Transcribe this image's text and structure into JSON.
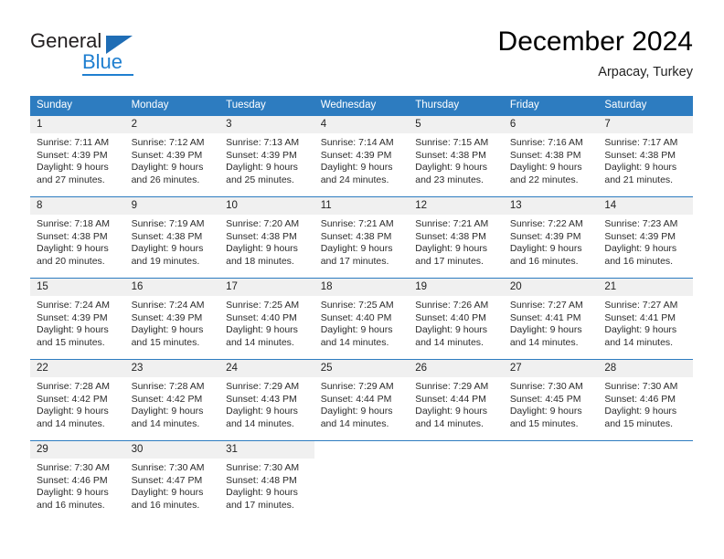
{
  "brand": {
    "name_part1": "General",
    "name_part2": "Blue",
    "triangle_color": "#1f6db5",
    "blue_color": "#1f7fd0"
  },
  "header": {
    "title": "December 2024",
    "subtitle": "Arpacay, Turkey",
    "header_bg": "#2d7cc0",
    "daynum_bg": "#f0f0f0"
  },
  "weekday_headers": [
    "Sunday",
    "Monday",
    "Tuesday",
    "Wednesday",
    "Thursday",
    "Friday",
    "Saturday"
  ],
  "weeks": [
    [
      {
        "day": "1",
        "sunrise": "Sunrise: 7:11 AM",
        "sunset": "Sunset: 4:39 PM",
        "daylight_l1": "Daylight: 9 hours",
        "daylight_l2": "and 27 minutes."
      },
      {
        "day": "2",
        "sunrise": "Sunrise: 7:12 AM",
        "sunset": "Sunset: 4:39 PM",
        "daylight_l1": "Daylight: 9 hours",
        "daylight_l2": "and 26 minutes."
      },
      {
        "day": "3",
        "sunrise": "Sunrise: 7:13 AM",
        "sunset": "Sunset: 4:39 PM",
        "daylight_l1": "Daylight: 9 hours",
        "daylight_l2": "and 25 minutes."
      },
      {
        "day": "4",
        "sunrise": "Sunrise: 7:14 AM",
        "sunset": "Sunset: 4:39 PM",
        "daylight_l1": "Daylight: 9 hours",
        "daylight_l2": "and 24 minutes."
      },
      {
        "day": "5",
        "sunrise": "Sunrise: 7:15 AM",
        "sunset": "Sunset: 4:38 PM",
        "daylight_l1": "Daylight: 9 hours",
        "daylight_l2": "and 23 minutes."
      },
      {
        "day": "6",
        "sunrise": "Sunrise: 7:16 AM",
        "sunset": "Sunset: 4:38 PM",
        "daylight_l1": "Daylight: 9 hours",
        "daylight_l2": "and 22 minutes."
      },
      {
        "day": "7",
        "sunrise": "Sunrise: 7:17 AM",
        "sunset": "Sunset: 4:38 PM",
        "daylight_l1": "Daylight: 9 hours",
        "daylight_l2": "and 21 minutes."
      }
    ],
    [
      {
        "day": "8",
        "sunrise": "Sunrise: 7:18 AM",
        "sunset": "Sunset: 4:38 PM",
        "daylight_l1": "Daylight: 9 hours",
        "daylight_l2": "and 20 minutes."
      },
      {
        "day": "9",
        "sunrise": "Sunrise: 7:19 AM",
        "sunset": "Sunset: 4:38 PM",
        "daylight_l1": "Daylight: 9 hours",
        "daylight_l2": "and 19 minutes."
      },
      {
        "day": "10",
        "sunrise": "Sunrise: 7:20 AM",
        "sunset": "Sunset: 4:38 PM",
        "daylight_l1": "Daylight: 9 hours",
        "daylight_l2": "and 18 minutes."
      },
      {
        "day": "11",
        "sunrise": "Sunrise: 7:21 AM",
        "sunset": "Sunset: 4:38 PM",
        "daylight_l1": "Daylight: 9 hours",
        "daylight_l2": "and 17 minutes."
      },
      {
        "day": "12",
        "sunrise": "Sunrise: 7:21 AM",
        "sunset": "Sunset: 4:38 PM",
        "daylight_l1": "Daylight: 9 hours",
        "daylight_l2": "and 17 minutes."
      },
      {
        "day": "13",
        "sunrise": "Sunrise: 7:22 AM",
        "sunset": "Sunset: 4:39 PM",
        "daylight_l1": "Daylight: 9 hours",
        "daylight_l2": "and 16 minutes."
      },
      {
        "day": "14",
        "sunrise": "Sunrise: 7:23 AM",
        "sunset": "Sunset: 4:39 PM",
        "daylight_l1": "Daylight: 9 hours",
        "daylight_l2": "and 16 minutes."
      }
    ],
    [
      {
        "day": "15",
        "sunrise": "Sunrise: 7:24 AM",
        "sunset": "Sunset: 4:39 PM",
        "daylight_l1": "Daylight: 9 hours",
        "daylight_l2": "and 15 minutes."
      },
      {
        "day": "16",
        "sunrise": "Sunrise: 7:24 AM",
        "sunset": "Sunset: 4:39 PM",
        "daylight_l1": "Daylight: 9 hours",
        "daylight_l2": "and 15 minutes."
      },
      {
        "day": "17",
        "sunrise": "Sunrise: 7:25 AM",
        "sunset": "Sunset: 4:40 PM",
        "daylight_l1": "Daylight: 9 hours",
        "daylight_l2": "and 14 minutes."
      },
      {
        "day": "18",
        "sunrise": "Sunrise: 7:25 AM",
        "sunset": "Sunset: 4:40 PM",
        "daylight_l1": "Daylight: 9 hours",
        "daylight_l2": "and 14 minutes."
      },
      {
        "day": "19",
        "sunrise": "Sunrise: 7:26 AM",
        "sunset": "Sunset: 4:40 PM",
        "daylight_l1": "Daylight: 9 hours",
        "daylight_l2": "and 14 minutes."
      },
      {
        "day": "20",
        "sunrise": "Sunrise: 7:27 AM",
        "sunset": "Sunset: 4:41 PM",
        "daylight_l1": "Daylight: 9 hours",
        "daylight_l2": "and 14 minutes."
      },
      {
        "day": "21",
        "sunrise": "Sunrise: 7:27 AM",
        "sunset": "Sunset: 4:41 PM",
        "daylight_l1": "Daylight: 9 hours",
        "daylight_l2": "and 14 minutes."
      }
    ],
    [
      {
        "day": "22",
        "sunrise": "Sunrise: 7:28 AM",
        "sunset": "Sunset: 4:42 PM",
        "daylight_l1": "Daylight: 9 hours",
        "daylight_l2": "and 14 minutes."
      },
      {
        "day": "23",
        "sunrise": "Sunrise: 7:28 AM",
        "sunset": "Sunset: 4:42 PM",
        "daylight_l1": "Daylight: 9 hours",
        "daylight_l2": "and 14 minutes."
      },
      {
        "day": "24",
        "sunrise": "Sunrise: 7:29 AM",
        "sunset": "Sunset: 4:43 PM",
        "daylight_l1": "Daylight: 9 hours",
        "daylight_l2": "and 14 minutes."
      },
      {
        "day": "25",
        "sunrise": "Sunrise: 7:29 AM",
        "sunset": "Sunset: 4:44 PM",
        "daylight_l1": "Daylight: 9 hours",
        "daylight_l2": "and 14 minutes."
      },
      {
        "day": "26",
        "sunrise": "Sunrise: 7:29 AM",
        "sunset": "Sunset: 4:44 PM",
        "daylight_l1": "Daylight: 9 hours",
        "daylight_l2": "and 14 minutes."
      },
      {
        "day": "27",
        "sunrise": "Sunrise: 7:30 AM",
        "sunset": "Sunset: 4:45 PM",
        "daylight_l1": "Daylight: 9 hours",
        "daylight_l2": "and 15 minutes."
      },
      {
        "day": "28",
        "sunrise": "Sunrise: 7:30 AM",
        "sunset": "Sunset: 4:46 PM",
        "daylight_l1": "Daylight: 9 hours",
        "daylight_l2": "and 15 minutes."
      }
    ],
    [
      {
        "day": "29",
        "sunrise": "Sunrise: 7:30 AM",
        "sunset": "Sunset: 4:46 PM",
        "daylight_l1": "Daylight: 9 hours",
        "daylight_l2": "and 16 minutes."
      },
      {
        "day": "30",
        "sunrise": "Sunrise: 7:30 AM",
        "sunset": "Sunset: 4:47 PM",
        "daylight_l1": "Daylight: 9 hours",
        "daylight_l2": "and 16 minutes."
      },
      {
        "day": "31",
        "sunrise": "Sunrise: 7:30 AM",
        "sunset": "Sunset: 4:48 PM",
        "daylight_l1": "Daylight: 9 hours",
        "daylight_l2": "and 17 minutes."
      },
      {
        "day": "",
        "sunrise": "",
        "sunset": "",
        "daylight_l1": "",
        "daylight_l2": ""
      },
      {
        "day": "",
        "sunrise": "",
        "sunset": "",
        "daylight_l1": "",
        "daylight_l2": ""
      },
      {
        "day": "",
        "sunrise": "",
        "sunset": "",
        "daylight_l1": "",
        "daylight_l2": ""
      },
      {
        "day": "",
        "sunrise": "",
        "sunset": "",
        "daylight_l1": "",
        "daylight_l2": ""
      }
    ]
  ]
}
